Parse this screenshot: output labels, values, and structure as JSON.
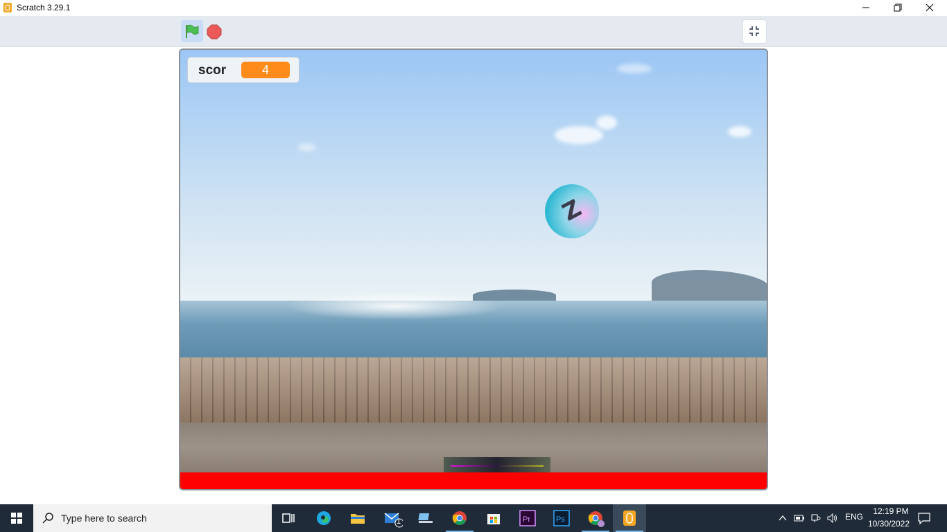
{
  "window": {
    "title": "Scratch 3.29.1"
  },
  "stage": {
    "monitor": {
      "label": "scor",
      "value": "4"
    },
    "ball_letter": "Z"
  },
  "taskbar": {
    "search_placeholder": "Type here to search",
    "mail_badge": "1",
    "tray": {
      "language": "ENG",
      "time": "12:19 PM",
      "date": "10/30/2022"
    }
  },
  "colors": {
    "flag_green": "#4caf50",
    "stop_red": "#ec5959",
    "monitor_orange": "#ff8c1a",
    "taskbar_bg": "#1f2b38"
  }
}
